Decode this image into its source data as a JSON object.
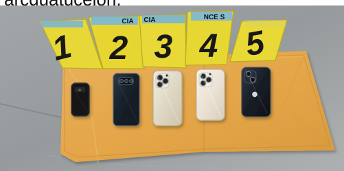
{
  "photo": {
    "caption_fragment": "arcguatucelon.",
    "scene_colors": {
      "pavement": "#9aa0a4",
      "envelope": "#e7aa4b",
      "marker_yellow": "#e6d72d",
      "marker_tape": "#7bb5d6"
    },
    "markers": [
      {
        "number": "1",
        "header_text": ""
      },
      {
        "number": "2",
        "header_text": "CIA"
      },
      {
        "number": "3",
        "header_text": "CIA"
      },
      {
        "number": "4",
        "header_text": "NCE S"
      },
      {
        "number": "5",
        "header_text": ""
      }
    ],
    "phones": [
      {
        "icon": "small-black-phone-icon",
        "color": "#121212"
      },
      {
        "icon": "samsung-phone-icon",
        "color": "#1e2832"
      },
      {
        "icon": "iphone-pro-gold-icon",
        "color": "#e6e0d1"
      },
      {
        "icon": "iphone-pro-white-icon",
        "color": "#ece5d8"
      },
      {
        "icon": "iphone-black-icon",
        "color": "#1a1f27"
      }
    ]
  }
}
